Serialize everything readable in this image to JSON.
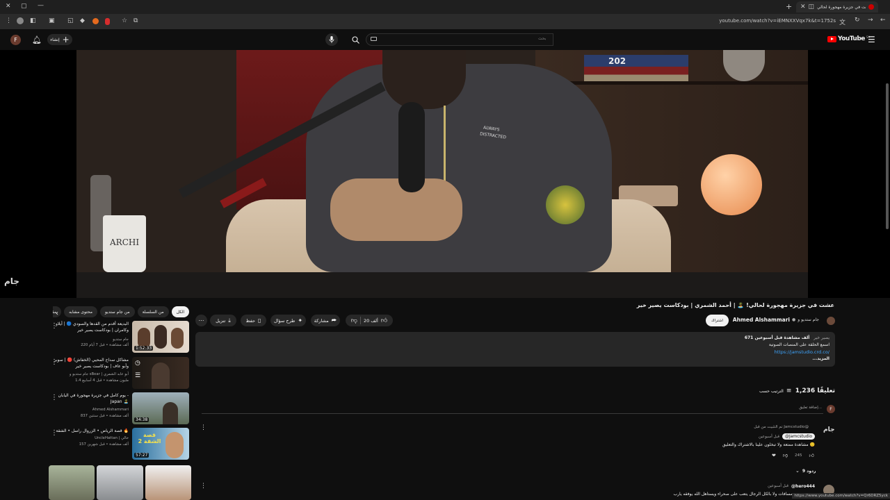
{
  "browser": {
    "tab_title": "عشت في جزيرة مهجورة لحالي...",
    "url": "youtube.com/watch?v=iEMNXXVqx7k&t=1752s",
    "status_url": "https://www.youtube.com/watch?v=Qr6DRZ5yck"
  },
  "youtube": {
    "logo_text": "YouTube",
    "region": "SA",
    "search_placeholder": "بحث",
    "create_label": "إنشاء",
    "avatar_letter": "F",
    "watermark": "جام"
  },
  "video": {
    "title": "عشت في جزيرة مهجورة لحالي! 🏝️ | أحمد الشمري | بودكاست يصير خير",
    "channel_name": "Ahmed Alshammari",
    "collab_with": "جام ستديو و",
    "subscribe_label": "اشتراك",
    "likes": "20 ألف",
    "share_label": "مشاركة",
    "ask_label": "طرح سؤال",
    "save_label": "حفظ",
    "download_label": "تنزيل",
    "hoodie_text_1": "ALWAYS",
    "hoodie_text_2": "DISTRACTED",
    "cup_text": "ARCHI",
    "book_text": "202"
  },
  "description": {
    "stats": "671 ألف مشاهدة  قبل أسبوعين",
    "tag": "يصير خير",
    "line1": "اسمع الحلقة على المنصات الصوتية",
    "link": "https://jamstudio.crd.co/",
    "more": "...المزيد"
  },
  "comments": {
    "count": "1,236 تعليقًا",
    "sort_label": "الترتيب حسب",
    "add_placeholder": "إضافة تعليق...",
    "user_avatar": "F",
    "pinned_label": "تم التثبيت من قبل Jamcstudio@",
    "c1_author": "@Jamcstudio",
    "c1_time": "قبل أسبوعين",
    "c1_text": "مشاهدة ممتعة ولا تبخلون علينا بالاشتراك والتعليق 🙂",
    "c1_likes": "245",
    "c1_replies": "9 ردود",
    "c2_author": "@hero444",
    "c2_time": "قبل أسبوعين",
    "c2_text": "مسافات ولا بالكل الرجال يتعب على صحراء ويستاهل الله يوفقه يارب"
  },
  "chips": [
    "الكل",
    "من السلسلة",
    "من جام ستديو",
    "محتوى مشابه",
    "مقاط"
  ],
  "related": [
    {
      "title": "البديعة أقدم من القدها والسودي 🔵 | أيلاو وكامران | بودكاست يصير خير",
      "channel": "جام ستديو",
      "meta": "220 ألف مشاهدة • قبل 7 أيام",
      "duration": "1:52:33"
    },
    {
      "title": "مشاكل سداح المحيي (الخفاش) 🔴 | سوبر وأبو عاف | بودكاست يصير خير",
      "channel": "جام ستديو و sBear | أبو عابد الشمري",
      "meta": "1.4 مليون مشاهدة • قبل 4 أسابيع",
      "duration": ""
    },
    {
      "title": "يوم كامل في جزيرة مهجورة في اليابان - Japan 🏝️",
      "channel": "Ahmed Alshammari",
      "meta": "837 ألف مشاهدة • قبل سنتين",
      "duration": "34:38"
    },
    {
      "title": "قصة الرياض • الزروال راسل • الشقة 🔥",
      "channel": "UncleHattan | خالي",
      "meta": "157 ألف مشاهدة • قبل شهرين",
      "duration": "57:27",
      "thumb_text": "قصة الشقة 2"
    }
  ]
}
